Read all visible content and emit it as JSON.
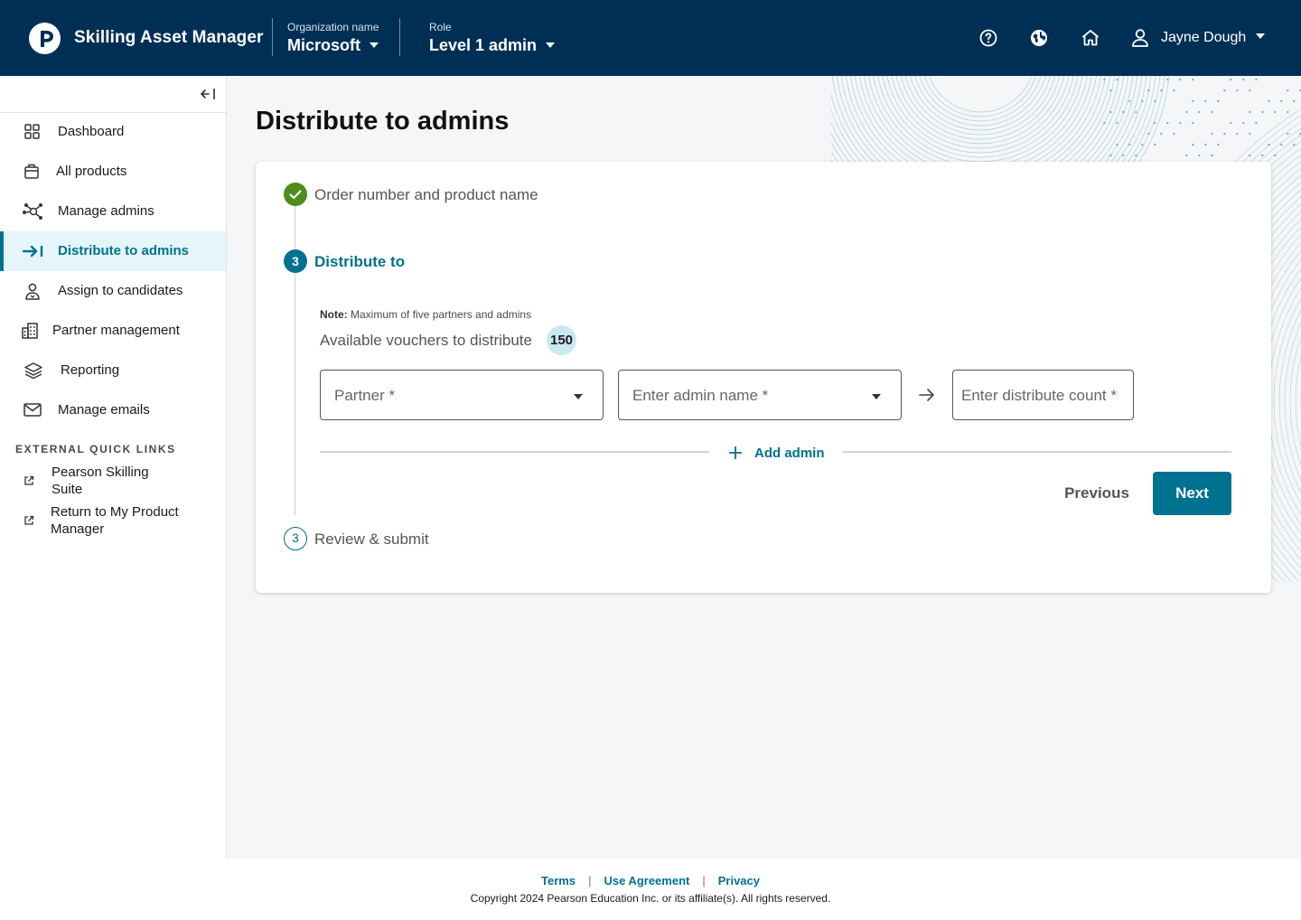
{
  "header": {
    "app_title": "Skilling Asset Manager",
    "org": {
      "label": "Organization name",
      "value": "Microsoft"
    },
    "role": {
      "label": "Role",
      "value": "Level 1 admin"
    },
    "icons": [
      "help-icon",
      "globe-icon",
      "home-icon",
      "user-icon"
    ],
    "user_name": "Jayne Dough"
  },
  "sidebar": {
    "items": [
      {
        "label": "Dashboard",
        "icon": "dashboard-icon"
      },
      {
        "label": "All products",
        "icon": "products-icon"
      },
      {
        "label": "Manage admins",
        "icon": "network-icon"
      },
      {
        "label": "Distribute to admins",
        "icon": "distribute-icon",
        "active": true
      },
      {
        "label": "Assign to candidates",
        "icon": "candidate-icon"
      },
      {
        "label": "Partner management",
        "icon": "building-icon"
      },
      {
        "label": "Reporting",
        "icon": "layers-icon"
      },
      {
        "label": "Manage emails",
        "icon": "mail-icon"
      }
    ],
    "quick_links_heading": "EXTERNAL QUICK LINKS",
    "quick_links": [
      {
        "line1": "Pearson Skilling",
        "line2": "Suite"
      },
      {
        "line1": "Return to My Product",
        "line2": "Manager"
      }
    ]
  },
  "main": {
    "page_title": "Distribute to admins",
    "steps": [
      {
        "label": "Order number and product name",
        "status": "complete"
      },
      {
        "number": "3",
        "label": "Distribute to",
        "status": "current"
      },
      {
        "number": "3",
        "label": "Review & submit",
        "status": "upcoming"
      }
    ],
    "note_label": "Note:",
    "note_text": "Maximum of five partners and admins",
    "available_label": "Available vouchers to distribute",
    "available_count": "150",
    "partner_placeholder": "Partner *",
    "admin_placeholder": "Enter admin name *",
    "count_placeholder": "Enter distribute count *",
    "add_admin_label": "Add admin",
    "previous_label": "Previous",
    "next_label": "Next"
  },
  "footer": {
    "links": [
      "Terms",
      "Use Agreement",
      "Privacy"
    ],
    "copyright": "Copyright 2024 Pearson Education Inc. or its affiliate(s). All rights reserved."
  },
  "colors": {
    "header_bg": "#002f56",
    "accent": "#00718f",
    "success": "#4c8d1b",
    "badge_bg": "#c9e9f2",
    "active_nav_bg": "#e5f6fb"
  }
}
